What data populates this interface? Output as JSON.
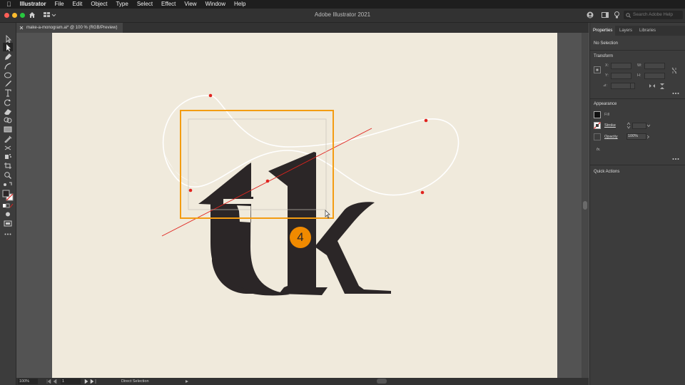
{
  "menubar": {
    "app_name": "Illustrator",
    "items": [
      "File",
      "Edit",
      "Object",
      "Type",
      "Select",
      "Effect",
      "View",
      "Window",
      "Help"
    ]
  },
  "window": {
    "title": "Adobe Illustrator 2021",
    "search_placeholder": "Search Adobe Help"
  },
  "document": {
    "tab_label": "make-a-monogram.ai* @ 100 % (RGB/Preview)"
  },
  "canvas": {
    "badge_number": "4"
  },
  "status": {
    "zoom": "100%",
    "artboard_number": "1",
    "tool_name": "Direct Selection"
  },
  "panel": {
    "tabs": [
      "Properties",
      "Layers",
      "Libraries"
    ],
    "selection_status": "No Selection",
    "transform": {
      "title": "Transform",
      "x_label": "X:",
      "y_label": "Y:",
      "w_label": "W:",
      "h_label": "H:",
      "angle_label": "⊿:"
    },
    "appearance": {
      "title": "Appearance",
      "fill_label": "Fill",
      "stroke_label": "Stroke",
      "opacity_label": "Opacity",
      "opacity_value": "100%",
      "fx_label": "fx."
    },
    "quick_actions": "Quick Actions"
  },
  "colors": {
    "artboard": "#f0eadc",
    "glyph": "#2b2627",
    "selection": "#f39c12",
    "anchor": "#e0231e",
    "badge": "#f08a00"
  }
}
